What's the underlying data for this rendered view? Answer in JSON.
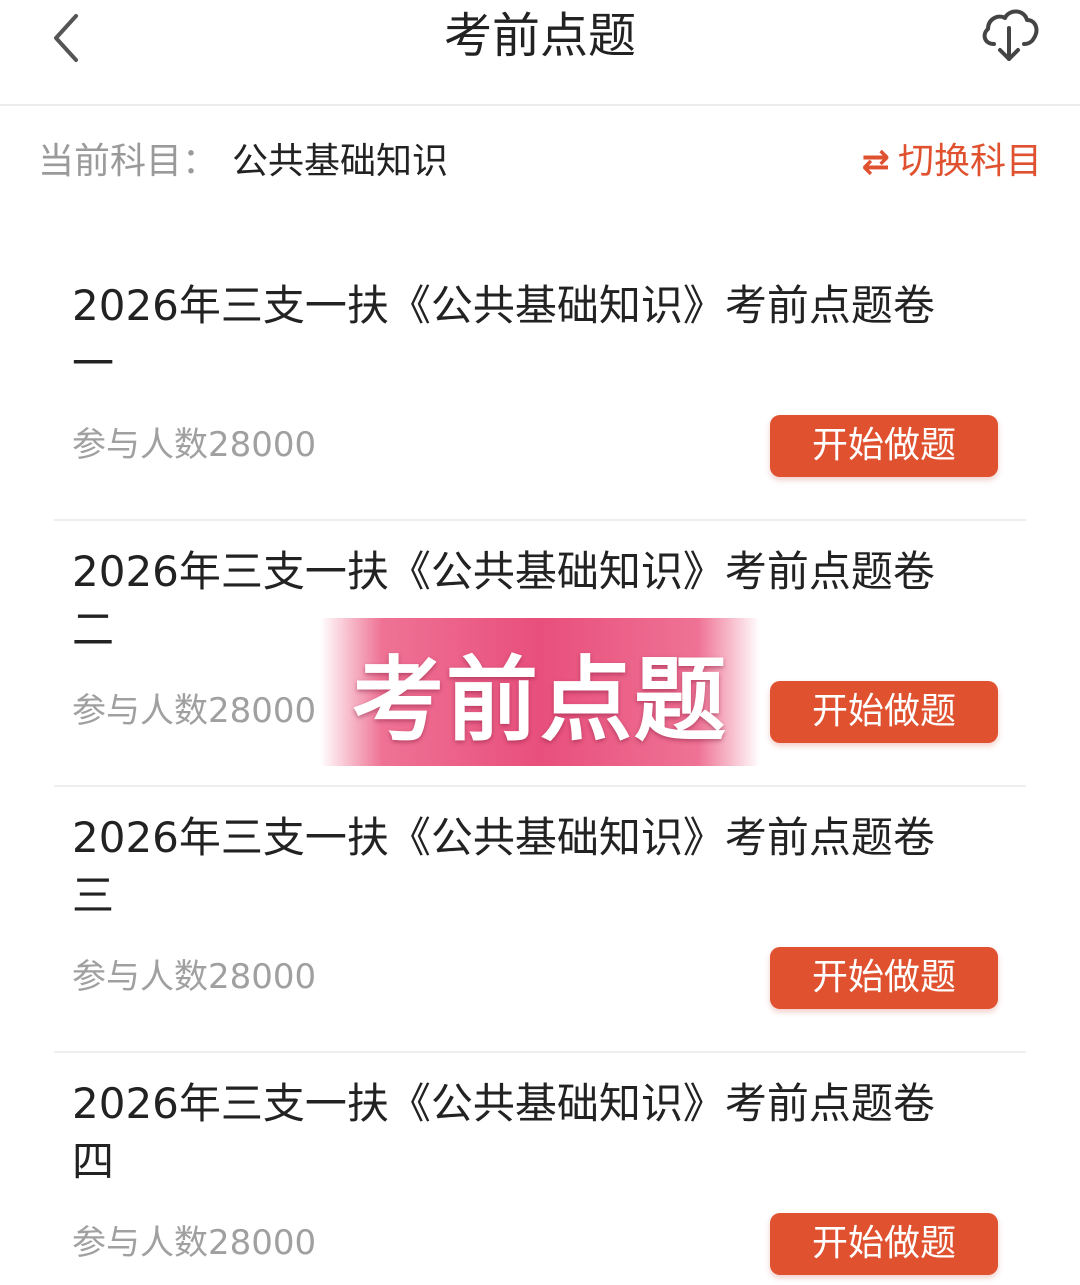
{
  "header": {
    "title": "考前点题",
    "back_icon": "chevron-left-icon",
    "download_icon": "cloud-download-icon"
  },
  "subject": {
    "prefix": "当前科目：",
    "name": "公共基础知识",
    "switch_icon": "⇄",
    "switch_label": "切换科目"
  },
  "papers": [
    {
      "title": "2026年三支一扶《公共基础知识》考前点题卷一",
      "participants": "参与人数28000",
      "button": "开始做题"
    },
    {
      "title": "2026年三支一扶《公共基础知识》考前点题卷二",
      "participants": "参与人数28000",
      "button": "开始做题"
    },
    {
      "title": "2026年三支一扶《公共基础知识》考前点题卷三",
      "participants": "参与人数28000",
      "button": "开始做题"
    },
    {
      "title": "2026年三支一扶《公共基础知识》考前点题卷四",
      "participants": "参与人数28000",
      "button": "开始做题"
    }
  ],
  "overlay": {
    "text": "考前点题"
  },
  "colors": {
    "accent": "#e0512f",
    "overlay": "#e84f7c"
  }
}
